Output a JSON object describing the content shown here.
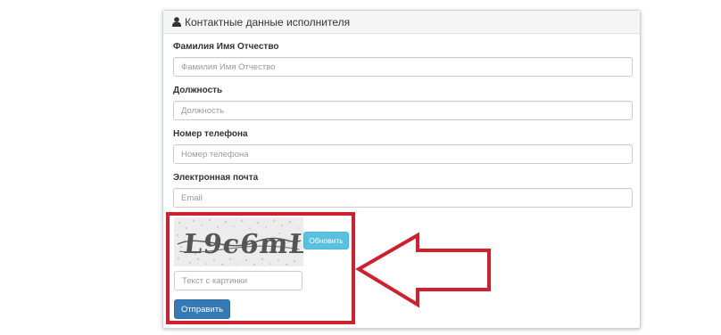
{
  "panel": {
    "title": "Контактные данные исполнителя",
    "icon": "user-icon"
  },
  "fields": {
    "full_name": {
      "label": "Фамилия Имя Отчество",
      "placeholder": "Фамилия Имя Отчество",
      "value": ""
    },
    "position": {
      "label": "Должность",
      "placeholder": "Должность",
      "value": ""
    },
    "phone": {
      "label": "Номер телефона",
      "placeholder": "Номер телефона",
      "value": ""
    },
    "email": {
      "label": "Электронная почта",
      "placeholder": "Email",
      "value": ""
    }
  },
  "captcha": {
    "image_text": "L9c6mL",
    "refresh_label": "Обновить",
    "input_placeholder": "Текст с картинки",
    "input_value": ""
  },
  "submit_label": "Отправить",
  "annotation": {
    "color": "#d0202e",
    "arrow_direction": "left"
  },
  "colors": {
    "primary_button": "#337ab7",
    "info_button": "#5bc0de"
  }
}
